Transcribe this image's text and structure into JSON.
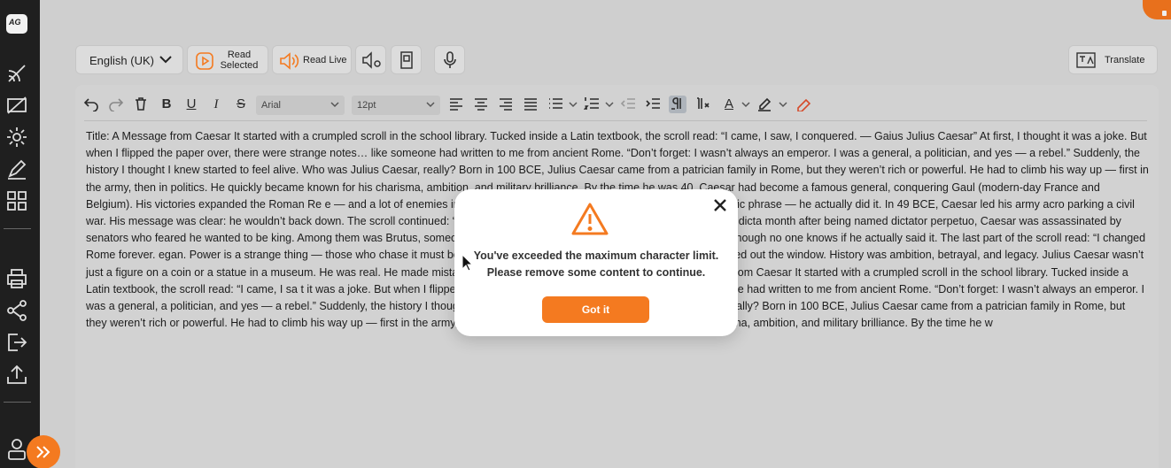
{
  "app": {
    "logo_text": "AG"
  },
  "toolbar": {
    "language": "English (UK)",
    "read_selected_line1": "Read",
    "read_selected_line2": "Selected",
    "read_live": "Read Live",
    "translate": "Translate"
  },
  "editor": {
    "font_family": "Arial",
    "font_size": "12pt",
    "text": "Title: A Message from Caesar It started with a crumpled scroll in the school library. Tucked inside a Latin textbook, the scroll read: “I came, I saw, I conquered. — Gaius Julius Caesar” At first, I thought it was a joke. But when I flipped the paper over, there were strange notes… like someone had written to me from ancient Rome. “Don’t forget: I wasn’t always an emperor. I was a general, a politician, and yes — a rebel.” Suddenly, the history I thought I knew started to feel alive.   Who was Julius Caesar, really? Born in 100 BCE, Julius Caesar came from a patrician family in Rome, but they weren’t rich or powerful. He had to climb his way up — first in the army, then in politics. He quickly became known for his charisma, ambition, and military brilliance. By the time he was 40, Caesar had become a famous general, conquering Gaul (modern-day France and Belgium). His victories expanded the Roman Re                                                          e — and a lot of enemies in the Senate. “Crossing the Rubicon” wasn’t just a dramatic phrase — he actually did it. In 49 BCE, Caesar led his army acro                                                          parking a civil war. His message was clear: he wouldn’t back down.   The scroll continued: “I never declared myself emperor. The Senate named me ‘dicta                                                          month after being named dictator perpetuo, Caesar was assassinated by senators who feared he wanted to be king. Among them was Brutus, someone Cae                                                          became one of the most famous lines in history, though no one knows if he actually said it.   The last part of the scroll read: “I changed Rome forever.                                                          egan. Power is a strange thing — those who chase it must be ready to lose everything.”   I closed the textbook and stared out the window. History was                                                          ambition, betrayal, and legacy. Julius Caesar wasn’t just a figure on a coin or a statue in a museum. He was real. He made mistakes. He changed the wo                                                          each me too. Title: A Message from Caesar It started with a crumpled scroll in the school library. Tucked inside a Latin textbook, the scroll read: “I came, I sa                                                          t it was a joke. But when I flipped the paper over, there were strange notes… like someone had written to me from ancient Rome. “Don’t forget: I wasn’t always an emperor. I was a general, a politician, and yes — a rebel.” Suddenly, the history I thought I knew started to feel alive.   Who was Julius Caesar, really? Born in 100 BCE, Julius Caesar came from a patrician family in Rome, but they weren’t rich or powerful. He had to climb his way up — first in the army, then in politics. He quickly became known for his charisma, ambition, and military brilliance. By the time he w"
  },
  "modal": {
    "line1": "You've exceeded the maximum character limit.",
    "line2": "Please remove some content to continue.",
    "button": "Got it"
  },
  "colors": {
    "accent": "#f47a20",
    "rail": "#1f1f1f"
  }
}
